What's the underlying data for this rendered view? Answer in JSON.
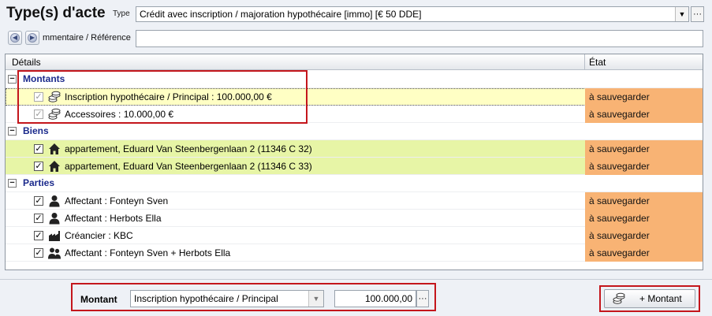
{
  "header": {
    "title": "Type(s) d'acte",
    "type_label": "Type",
    "type_value": "Crédit avec inscription / majoration hypothécaire [immo] [€ 50 DDE]",
    "dropdown_glyph": "▼",
    "more_glyph": "···"
  },
  "comment": {
    "label": "mmentaire / Référence",
    "value": ""
  },
  "grid": {
    "columns": {
      "details": "Détails",
      "etat": "État"
    },
    "groups": {
      "montants": {
        "title": "Montants",
        "rows": [
          {
            "text": "Inscription hypothécaire / Principal : 100.000,00 €",
            "status": "à sauvegarder"
          },
          {
            "text": "Accessoires : 10.000,00 €",
            "status": "à sauvegarder"
          }
        ]
      },
      "biens": {
        "title": "Biens",
        "rows": [
          {
            "text": "appartement, Eduard Van Steenbergenlaan 2 (11346 C 32)",
            "status": "à sauvegarder"
          },
          {
            "text": "appartement, Eduard Van Steenbergenlaan 2 (11346 C 33)",
            "status": "à sauvegarder"
          }
        ]
      },
      "parties": {
        "title": "Parties",
        "rows": [
          {
            "text": "Affectant : Fonteyn Sven",
            "status": "à sauvegarder"
          },
          {
            "text": "Affectant : Herbots Ella",
            "status": "à sauvegarder"
          },
          {
            "text": "Créancier : KBC",
            "status": "à sauvegarder"
          },
          {
            "text": "Affectant : Fonteyn Sven + Herbots Ella",
            "status": "à sauvegarder"
          }
        ]
      }
    },
    "colors": {
      "highlight_yellow": "#ffffc4",
      "highlight_green": "#e7f5a6",
      "status_orange": "#f8b374",
      "group_title": "#1b2a8c",
      "annotation_red": "#c4161c"
    }
  },
  "bottom": {
    "montant_label": "Montant",
    "montant_select": "Inscription hypothécaire / Principal",
    "amount_value": "100.000,00",
    "more_glyph": "···",
    "add_button": "+ Montant"
  }
}
